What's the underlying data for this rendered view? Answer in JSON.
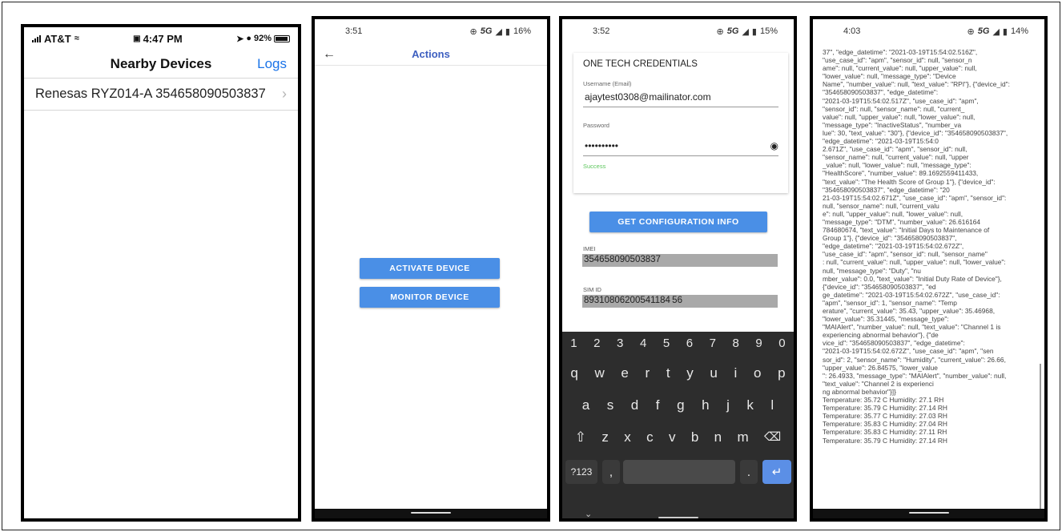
{
  "phone1": {
    "carrier": "AT&T",
    "time": "4:47 PM",
    "battery": "92%",
    "title": "Nearby Devices",
    "logs_label": "Logs",
    "devices": [
      {
        "label": "Renesas RYZ014-A 354658090503837"
      }
    ]
  },
  "phone2": {
    "time": "3:51",
    "network": "5G",
    "battery": "16%",
    "title": "Actions",
    "activate_label": "ACTIVATE DEVICE",
    "monitor_label": "MONITOR DEVICE"
  },
  "phone3": {
    "time": "3:52",
    "network": "5G",
    "battery": "15%",
    "card_title": "ONE TECH CREDENTIALS",
    "username_label": "Username (Email)",
    "username_value": "ajaytest0308@mailinator.com",
    "password_label": "Password",
    "password_value": "••••••••••",
    "success_text": "Success",
    "config_button": "GET CONFIGURATION INFO",
    "imei_label": "IMEI",
    "imei_value": "354658090503837",
    "sim_label": "SIM ID",
    "sim_value": "89310806200541184 56",
    "keyboard": {
      "numbers": [
        "1",
        "2",
        "3",
        "4",
        "5",
        "6",
        "7",
        "8",
        "9",
        "0"
      ],
      "row1": [
        "q",
        "w",
        "e",
        "r",
        "t",
        "y",
        "u",
        "i",
        "o",
        "p"
      ],
      "row2": [
        "a",
        "s",
        "d",
        "f",
        "g",
        "h",
        "j",
        "k",
        "l"
      ],
      "row3": [
        "z",
        "x",
        "c",
        "v",
        "b",
        "n",
        "m"
      ],
      "sym_label": "?123",
      "comma": ",",
      "period": "."
    }
  },
  "phone4": {
    "time": "4:03",
    "network": "5G",
    "battery": "14%",
    "log_lines": [
      "37\", \"edge_datetime\": \"2021-03-19T15:54:02.516Z\",",
      "\"use_case_id\": \"apm\", \"sensor_id\": null, \"sensor_n",
      "ame\": null, \"current_value\": null, \"upper_value\": null,",
      "\"lower_value\": null, \"message_type\": \"Device",
      "Name\", \"number_value\": null, \"text_value\": \"RPI\"}, {\"device_id\":",
      "\"354658090503837\", \"edge_datetime\":",
      "\"2021-03-19T15:54:02.517Z\", \"use_case_id\": \"apm\",",
      "\"sensor_id\": null, \"sensor_name\": null, \"current_",
      "value\": null, \"upper_value\": null, \"lower_value\": null,",
      "\"message_type\": \"InactiveStatus\", \"number_va",
      "lue\": 30, \"text_value\": \"30\"}, {\"device_id\": \"354658090503837\",",
      "\"edge_datetime\": \"2021-03-19T15:54:0",
      "2.671Z\", \"use_case_id\": \"apm\", \"sensor_id\": null,",
      "\"sensor_name\": null, \"current_value\": null, \"upper",
      "_value\": null, \"lower_value\": null, \"message_type\":",
      "\"HealthScore\", \"number_value\": 89.1692559411433,",
      "\"text_value\": \"The Health Score of Group 1\"}, {\"device_id\":",
      "\"354658090503837\", \"edge_datetime\": \"20",
      "21-03-19T15:54:02.671Z\", \"use_case_id\": \"apm\", \"sensor_id\":",
      "null, \"sensor_name\": null, \"current_valu",
      "e\": null, \"upper_value\": null, \"lower_value\": null,",
      "\"message_type\": \"DTM\", \"number_value\": 26.616164",
      "784680674, \"text_value\": \"Initial Days to Maintenance of",
      "Group 1\"}, {\"device_id\": \"354658090503837\",",
      "\"edge_datetime\": \"2021-03-19T15:54:02.672Z\",",
      "\"use_case_id\": \"apm\", \"sensor_id\": null, \"sensor_name\"",
      ": null, \"current_value\": null, \"upper_value\": null, \"lower_value\":",
      "null, \"message_type\": \"Duty\", \"nu",
      "mber_value\": 0.0, \"text_value\": \"Initial Duty Rate of Device\"},",
      "{\"device_id\": \"354658090503837\", \"ed",
      "ge_datetime\": \"2021-03-19T15:54:02.672Z\", \"use_case_id\":",
      "\"apm\", \"sensor_id\": 1, \"sensor_name\": \"Temp",
      "erature\", \"current_value\": 35.43, \"upper_value\": 35.46968,",
      "\"lower_value\": 35.31445, \"message_type\":",
      "\"MAIAlert\", \"number_value\": null, \"text_value\": \"Channel 1 is",
      "experiencing abnormal behavior\"}, {\"de",
      "vice_id\": \"354658090503837\", \"edge_datetime\":",
      "\"2021-03-19T15:54:02.672Z\", \"use_case_id\": \"apm\", \"sen",
      "sor_id\": 2, \"sensor_name\": \"Humidity\", \"current_value\": 26.66,",
      "\"upper_value\": 26.84575, \"lower_value",
      "\": 26.4933, \"message_type\": \"MAIAlert\", \"number_value\": null,",
      "\"text_value\": \"Channel 2 is experienci",
      "ng abnormal behavior\"}]}",
      "Temperature: 35.72 C Humidity: 27.1 RH",
      "Temperature: 35.79 C Humidity: 27.14 RH",
      "Temperature: 35.77 C Humidity: 27.03 RH",
      "Temperature: 35.83 C Humidity: 27.04 RH",
      "Temperature: 35.83 C Humidity: 27.11 RH",
      "Temperature: 35.79 C Humidity: 27.14 RH"
    ]
  },
  "colors": {
    "accent_blue": "#4a8fe6",
    "ios_link": "#1a73e8",
    "title_blue": "#3d5fc0",
    "success_green": "#5ec75e",
    "keyboard_bg": "#2d2d2d",
    "enter_key": "#5b8fe6"
  }
}
